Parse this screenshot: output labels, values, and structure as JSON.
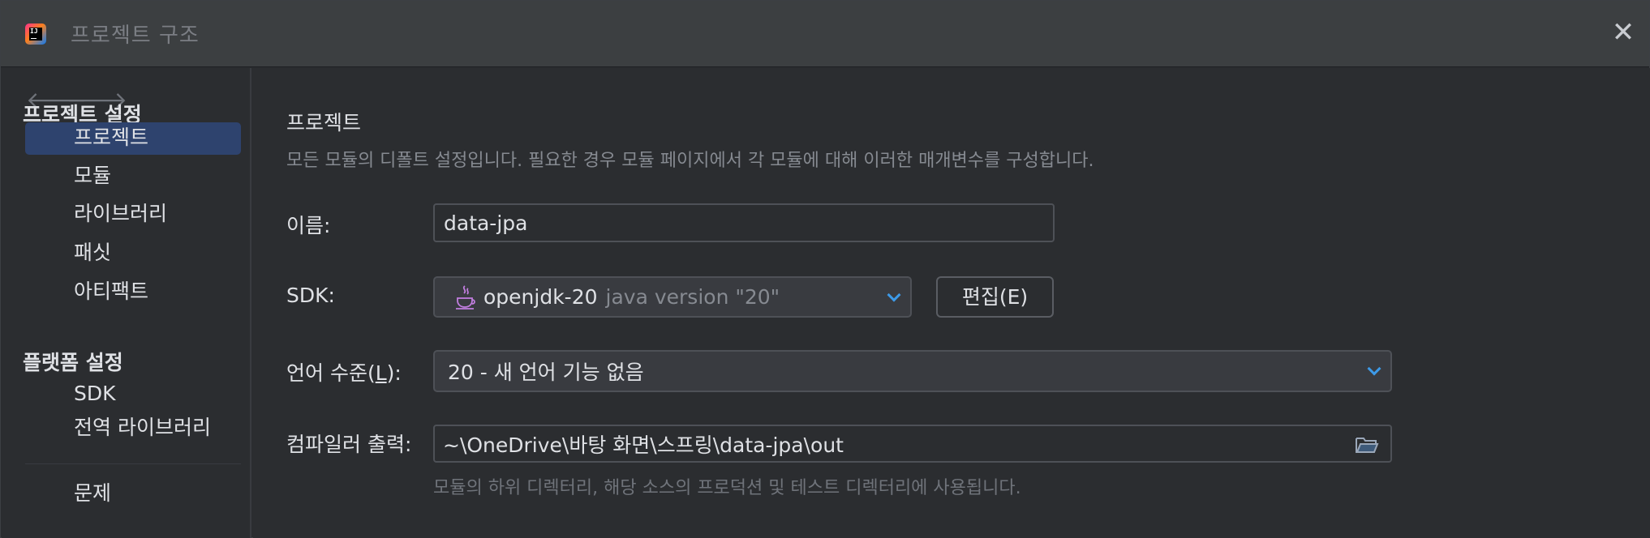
{
  "window": {
    "title": "프로젝트 구조",
    "close_label": "✕"
  },
  "sidebar": {
    "back_label": "🡐",
    "forward_label": "🡒",
    "group_project": "프로젝트 설정",
    "group_platform": "플랫폼 설정",
    "items": [
      {
        "label": "프로젝트"
      },
      {
        "label": "모듈"
      },
      {
        "label": "라이브러리"
      },
      {
        "label": "패싯"
      },
      {
        "label": "아티팩트"
      },
      {
        "label": "SDK"
      },
      {
        "label": "전역 라이브러리"
      },
      {
        "label": "문제"
      }
    ]
  },
  "main": {
    "title": "프로젝트",
    "description": "모든 모듈의 디폴트 설정입니다. 필요한 경우 모듈 페이지에서 각 모듈에 대해 이러한 매개변수를 구성합니다.",
    "name_label": "이름:",
    "name_value": "data-jpa",
    "sdk_label": "SDK:",
    "sdk_name": "openjdk-20",
    "sdk_version": "java version \"20\"",
    "edit_button": "편집(E)",
    "lang_label_prefix": "언어 수준(",
    "lang_label_mnemonic": "L",
    "lang_label_suffix": "):",
    "lang_value": "20 - 새 언어 기능 없음",
    "output_label": "컴파일러 출력:",
    "output_value": "~\\OneDrive\\바탕 화면\\스프링\\data-jpa\\out",
    "output_hint": "모듈의 하위 디렉터리, 해당 소스의 프로덕션 및 테스트 디렉터리에 사용됩니다."
  },
  "icons": {
    "app": "intellij-idea-icon",
    "java": "java-cup-icon",
    "folder": "folder-open-icon"
  },
  "colors": {
    "selection": "#2e436e",
    "accent": "#3d9ae8",
    "background": "#2b2d30"
  }
}
